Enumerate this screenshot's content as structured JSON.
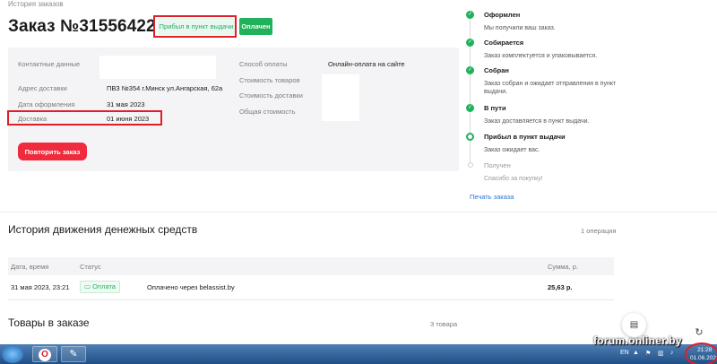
{
  "breadcrumb": "История заказов",
  "order": {
    "title": "Заказ №31556422",
    "status_badge": "Прибыл в пункт выдачи",
    "paid_badge": "Оплачен"
  },
  "info": {
    "contact_label": "Контактные данные",
    "address_label": "Адрес доставки",
    "address_value": "ПВЗ №354 г.Минск ул.Ангарская, 62а",
    "date_label": "Дата оформления",
    "date_value": "31 мая 2023",
    "delivery_label": "Доставка",
    "delivery_value": "01 июня 2023",
    "payment_label": "Способ оплаты",
    "payment_value": "Онлайн-оплата на сайте",
    "goods_cost_label": "Стоимость товаров",
    "delivery_cost_label": "Стоимость доставки",
    "total_label": "Общая стоимость",
    "repeat_button": "Повторить заказ"
  },
  "timeline": [
    {
      "title": "Оформлен",
      "desc": "Мы получили ваш заказ.",
      "state": "done",
      "icon": "check-icon"
    },
    {
      "title": "Собирается",
      "desc": "Заказ комплектуется и упаковывается.",
      "state": "done",
      "icon": "check-icon"
    },
    {
      "title": "Собран",
      "desc": "Заказ собран и ожидает отправления в пункт выдачи.",
      "state": "done",
      "icon": "check-icon"
    },
    {
      "title": "В пути",
      "desc": "Заказ доставляется в пункт выдачи.",
      "state": "done",
      "icon": "check-icon"
    },
    {
      "title": "Прибыл в пункт выдачи",
      "desc": "Заказ ожидает вас.",
      "state": "current",
      "icon": "current-dot-icon"
    },
    {
      "title": "Получен",
      "desc": "Спасибо за покупку!",
      "state": "pending",
      "icon": "pending-dot-icon"
    }
  ],
  "print_link": "Печать заказа",
  "money_history": {
    "title": "История движения денежных средств",
    "count": "1 операция",
    "columns": [
      "Дата, время",
      "Статус",
      "Сумма, р."
    ],
    "rows": [
      {
        "datetime": "31 мая 2023, 23:21",
        "status": "Оплата",
        "description": "Оплачено через belassist.by",
        "amount": "25,63 р."
      }
    ]
  },
  "goods": {
    "title": "Товары в заказе",
    "count": "3 товара"
  },
  "taskbar": {
    "lang": "EN",
    "time": "21:28",
    "date": "01.06.2023"
  },
  "watermark": "forum.onliner.by",
  "colors": {
    "accent_green": "#20b25a",
    "accent_red": "#ef2b3d",
    "link_blue": "#2a73d8",
    "annotation_red": "#e01e27"
  }
}
